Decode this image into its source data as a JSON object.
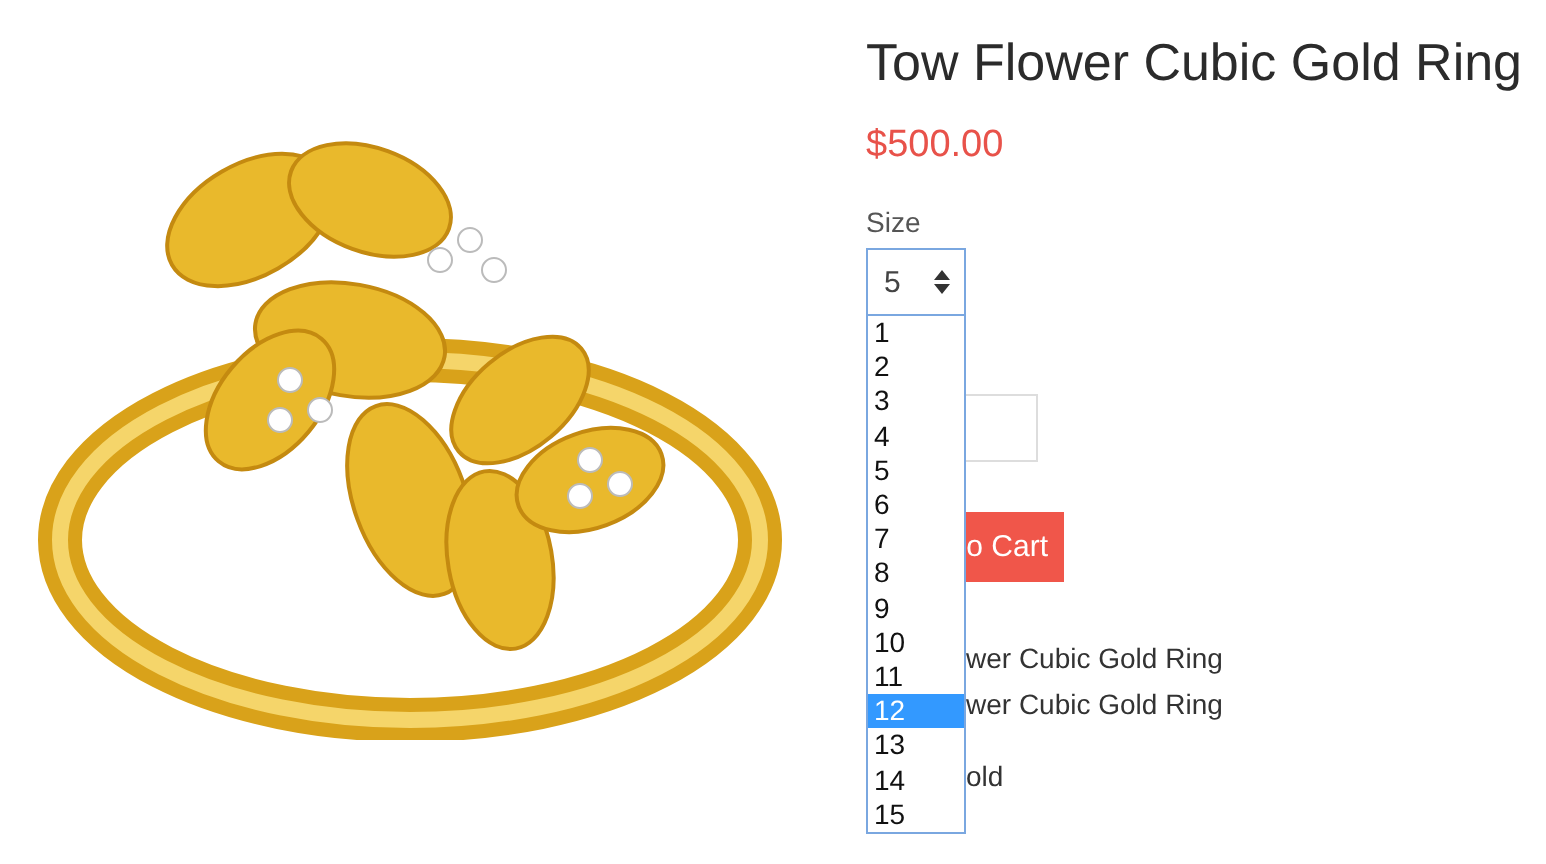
{
  "product": {
    "title": "Tow Flower Cubic Gold Ring",
    "price": "$500.00"
  },
  "size": {
    "label": "Size",
    "value": "5",
    "options": [
      {
        "label": "1",
        "highlighted": false
      },
      {
        "label": "2",
        "highlighted": false
      },
      {
        "label": "3",
        "highlighted": false
      },
      {
        "label": "4",
        "highlighted": false
      },
      {
        "label": "5",
        "highlighted": false
      },
      {
        "label": "6",
        "highlighted": false
      },
      {
        "label": "7",
        "highlighted": false
      },
      {
        "label": "8",
        "highlighted": false
      },
      {
        "label": "9",
        "highlighted": false
      },
      {
        "label": "10",
        "highlighted": false
      },
      {
        "label": "11",
        "highlighted": false
      },
      {
        "label": "12",
        "highlighted": true
      },
      {
        "label": "13",
        "highlighted": false
      },
      {
        "label": "14",
        "highlighted": false
      },
      {
        "label": "15",
        "highlighted": false
      }
    ]
  },
  "cart_button": {
    "label": "o Cart"
  },
  "details": [
    "wer Cubic Gold Ring",
    "wer Cubic Gold Ring",
    "old"
  ]
}
